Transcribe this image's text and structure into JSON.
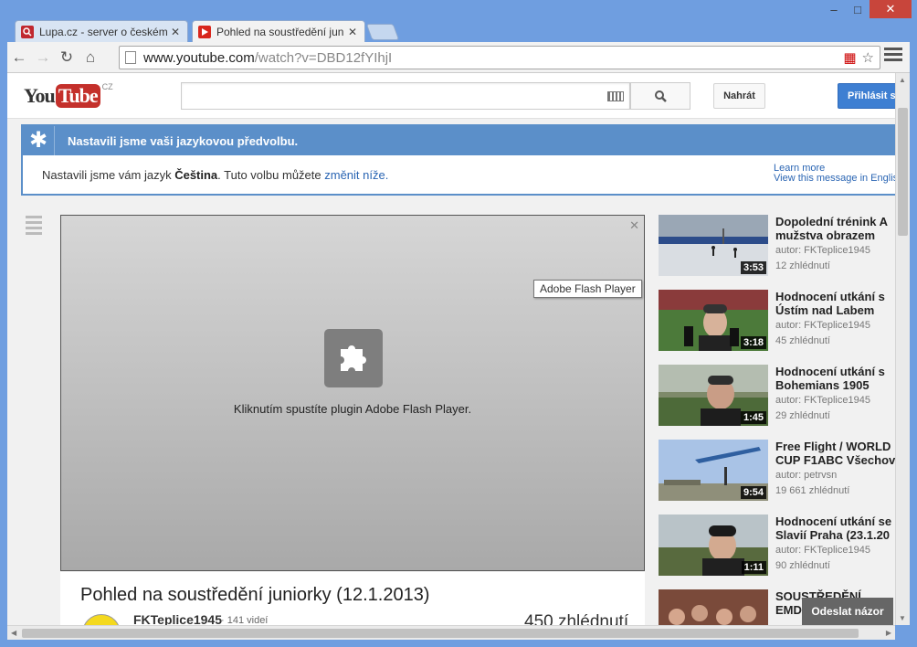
{
  "window": {
    "controls": {
      "minimize": "–",
      "maximize": "□",
      "close": "✕"
    }
  },
  "tabs": [
    {
      "title": "Lupa.cz - server o českém",
      "icon": "lupa-favicon",
      "color": "#c0282f",
      "close": "✕"
    },
    {
      "title": "Pohled na soustředění jun",
      "icon": "youtube-favicon",
      "color": "#d8261c",
      "close": "✕"
    }
  ],
  "toolbar": {
    "url_host": "www.youtube.com",
    "url_path": "/watch?v=DBD12fYIhjI"
  },
  "masthead": {
    "logo_you": "You",
    "logo_tube": "Tube",
    "logo_country": "CZ",
    "search_placeholder": "",
    "upload_label": "Nahrát",
    "signin_label": "Přihlásit s"
  },
  "lang_banner": {
    "title": "Nastavili jsme vaši jazykovou předvolbu.",
    "body_prefix": "Nastavili jsme vám jazyk ",
    "language": "Čeština",
    "body_middle": ". Tuto volbu můžete ",
    "change_link": "změnit níže.",
    "learn_more": "Learn more",
    "view_english": "View this message in English"
  },
  "player": {
    "tooltip": "Adobe Flash Player",
    "plugin_message": "Kliknutím spustíte plugin Adobe Flash Player.",
    "close": "✕"
  },
  "video": {
    "title": "Pohled na soustředění juniorky (12.1.2013)",
    "owner": "FKTeplice1945",
    "owner_videos": "· 141 videí",
    "views": "450 zhlédnutí"
  },
  "related": [
    {
      "title": "Dopolední trénink A\nmužstva obrazem",
      "author": "autor: FKTeplice1945",
      "views": "12 zhlédnutí",
      "duration": "3:53",
      "scene": "snow"
    },
    {
      "title": "Hodnocení utkání s\nÚstím nad Labem",
      "author": "autor: FKTeplice1945",
      "views": "45 zhlédnutí",
      "duration": "3:18",
      "scene": "interview"
    },
    {
      "title": "Hodnocení utkání s\nBohemians 1905",
      "author": "autor: FKTeplice1945",
      "views": "29 zhlédnutí",
      "duration": "1:45",
      "scene": "interview2"
    },
    {
      "title": "Free Flight / WORLD\nCUP F1ABC Všechov",
      "author": "autor: petrvsn",
      "views": "19 661 zhlédnutí",
      "duration": "9:54",
      "scene": "sky"
    },
    {
      "title": "Hodnocení utkání se\nSlavií Praha (23.1.20",
      "author": "autor: FKTeplice1945",
      "views": "90 zhlédnutí",
      "duration": "1:11",
      "scene": "interview3"
    },
    {
      "title": "SOUSTŘEDĚNÍ\nEMD",
      "author": "",
      "views": "",
      "duration": "",
      "scene": "crowd"
    }
  ],
  "feedback_label": "Odeslat názor",
  "colors": {
    "accent": "#5b8fc9",
    "signin": "#3e7fd2",
    "youtube_red": "#c4302b"
  }
}
